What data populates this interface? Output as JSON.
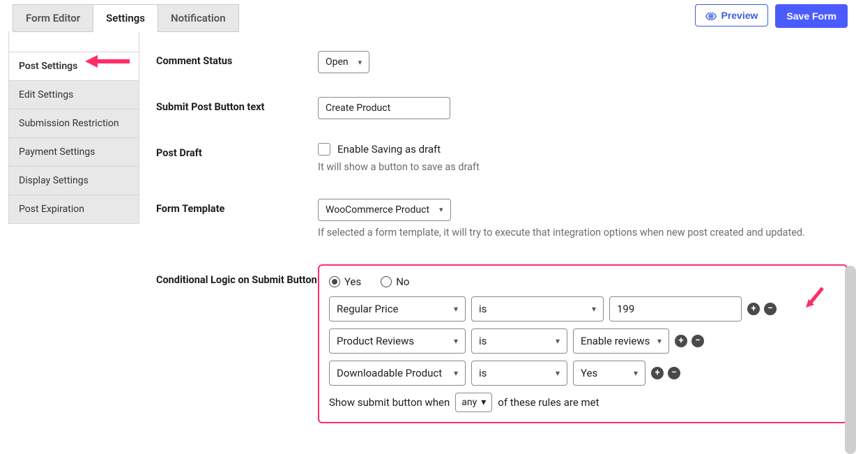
{
  "top": {
    "tabs": [
      "Form Editor",
      "Settings",
      "Notification"
    ],
    "active": 1,
    "preview": "Preview",
    "save": "Save Form"
  },
  "sidebar": {
    "items": [
      "Post Settings",
      "Edit Settings",
      "Submission Restriction",
      "Payment Settings",
      "Display Settings",
      "Post Expiration"
    ],
    "active": 0
  },
  "fields": {
    "comment_status": {
      "label": "Comment Status",
      "value": "Open"
    },
    "submit_text": {
      "label": "Submit Post Button text",
      "value": "Create Product"
    },
    "post_draft": {
      "label": "Post Draft",
      "check_label": "Enable Saving as draft",
      "helper": "It will show a button to save as draft"
    },
    "form_template": {
      "label": "Form Template",
      "value": "WooCommerce Product",
      "helper": "If selected a form template, it will try to execute that integration options when new post created and updated."
    },
    "cond": {
      "label": "Conditional Logic on Submit Button",
      "yes": "Yes",
      "no": "No",
      "selected": "yes",
      "rules": [
        {
          "field": "Regular Price",
          "op": "is",
          "value": "199",
          "value_type": "text",
          "fw": 196,
          "ow": 190,
          "vw": 190
        },
        {
          "field": "Product Reviews",
          "op": "is",
          "value": "Enable reviews",
          "value_type": "select",
          "fw": 196,
          "ow": 138,
          "vw": 138
        },
        {
          "field": "Downloadable Product",
          "op": "is",
          "value": "Yes",
          "value_type": "select",
          "fw": 196,
          "ow": 138,
          "vw": 104
        }
      ],
      "footer_pre": "Show submit button when",
      "footer_match": "any",
      "footer_post": "of these rules are met"
    }
  }
}
